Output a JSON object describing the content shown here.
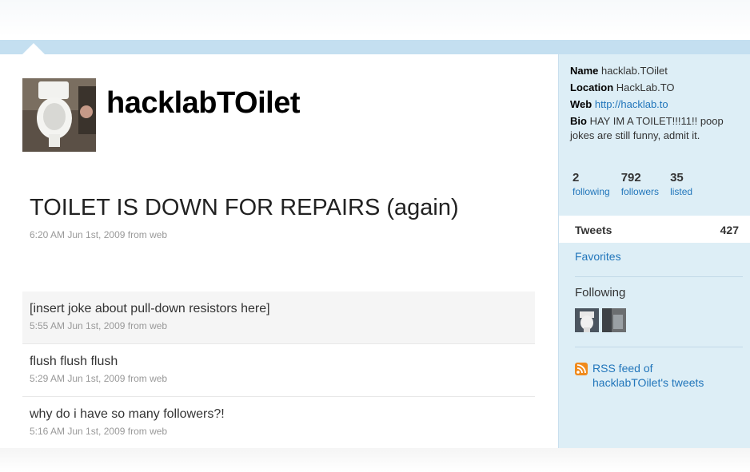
{
  "profile": {
    "screen_name": "hacklabTOilet",
    "avatar_icon": "toilet-photo"
  },
  "latest_tweet": {
    "text": "TOILET IS DOWN FOR REPAIRS (again)",
    "meta": "6:20 AM Jun 1st, 2009 from web"
  },
  "timeline": [
    {
      "text": "[insert joke about pull-down resistors here]",
      "meta": "5:55 AM Jun 1st, 2009 from web"
    },
    {
      "text": "flush flush flush",
      "meta": "5:29 AM Jun 1st, 2009 from web"
    },
    {
      "text": "why do i have so many followers?!",
      "meta": "5:16 AM Jun 1st, 2009 from web"
    }
  ],
  "sidebar": {
    "name_label": "Name",
    "name_value": "hacklab.TOilet",
    "location_label": "Location",
    "location_value": "HackLab.TO",
    "web_label": "Web",
    "web_value": "http://hacklab.to",
    "bio_label": "Bio",
    "bio_value": "HAY IM A TOILET!!!11!! poop jokes are still funny, admit it.",
    "stats": [
      {
        "num": "2",
        "label": "following"
      },
      {
        "num": "792",
        "label": "followers"
      },
      {
        "num": "35",
        "label": "listed"
      }
    ],
    "tweets_label": "Tweets",
    "tweets_count": "427",
    "favorites_label": "Favorites",
    "following_title": "Following",
    "rss_text": "RSS feed of hacklabTOilet's tweets",
    "rss_icon": "rss-icon"
  },
  "colors": {
    "link": "#2276bb",
    "sidebar_bg": "#ddeef6",
    "band": "#c4dff0"
  }
}
